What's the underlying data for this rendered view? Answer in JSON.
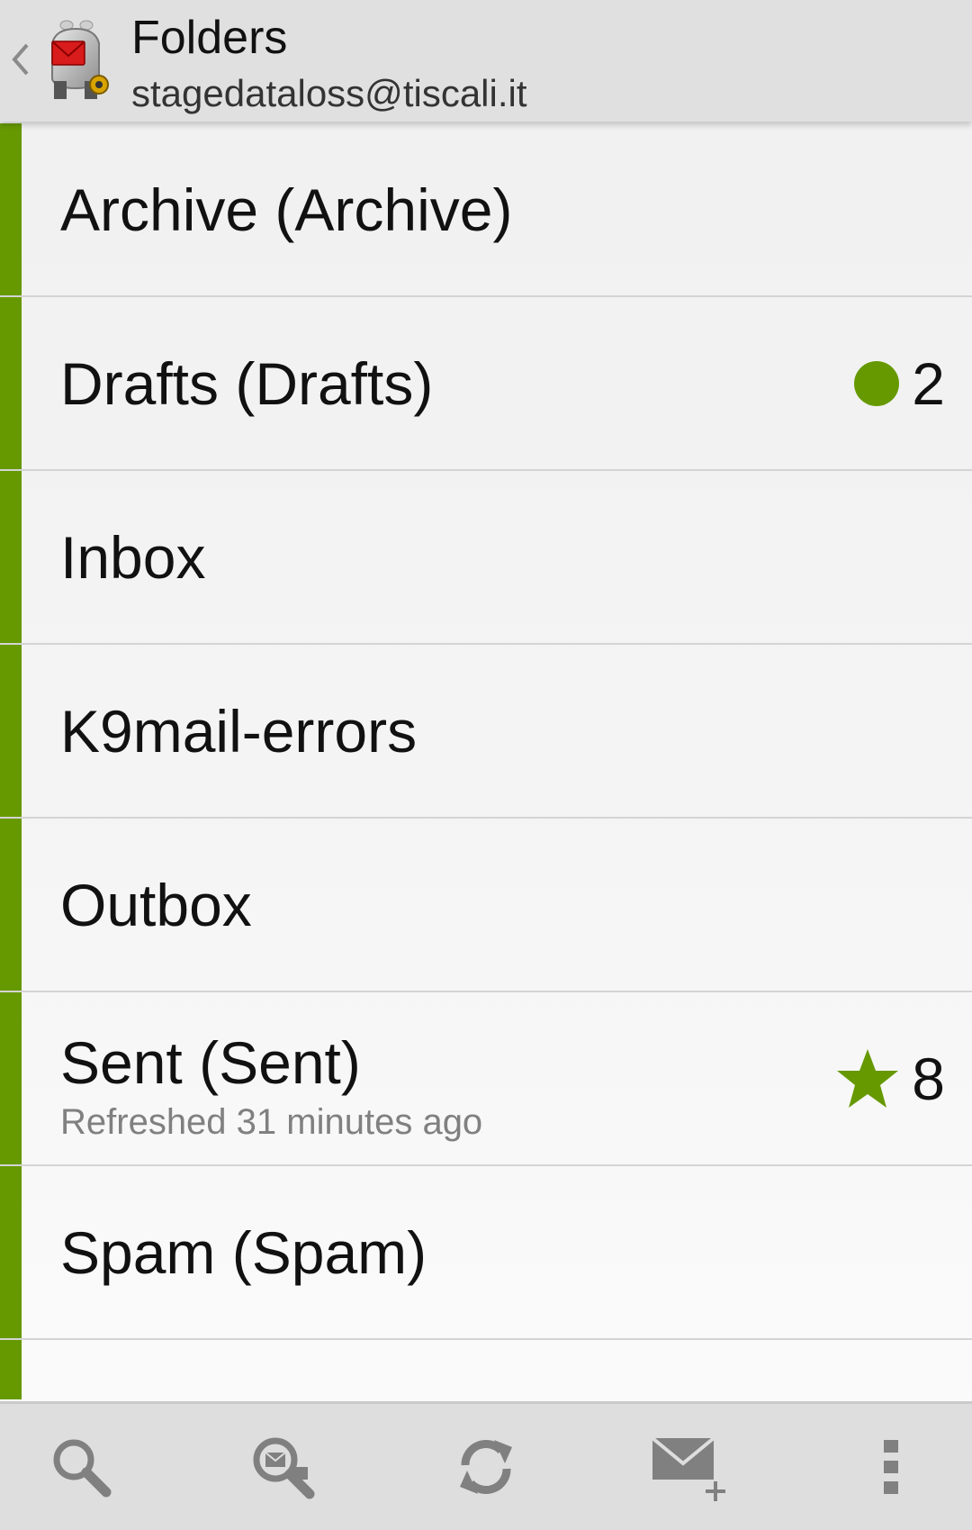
{
  "header": {
    "title": "Folders",
    "subtitle": "stagedataloss@tiscali.it",
    "back_icon": "chevron-left-icon",
    "logo_icon": "k9-mail-logo"
  },
  "accent_color": "#669900",
  "folders": [
    {
      "name": "Archive (Archive)",
      "status": "",
      "count": "",
      "count_icon": ""
    },
    {
      "name": "Drafts (Drafts)",
      "status": "",
      "count": "2",
      "count_icon": "unread-dot-icon"
    },
    {
      "name": "Inbox",
      "status": "",
      "count": "",
      "count_icon": ""
    },
    {
      "name": "K9mail-errors",
      "status": "",
      "count": "",
      "count_icon": ""
    },
    {
      "name": "Outbox",
      "status": "",
      "count": "",
      "count_icon": ""
    },
    {
      "name": "Sent (Sent)",
      "status": "Refreshed 31 minutes ago",
      "count": "8",
      "count_icon": "star-icon"
    },
    {
      "name": "Spam (Spam)",
      "status": "",
      "count": "",
      "count_icon": ""
    }
  ],
  "toolbar": {
    "items": [
      "search-icon",
      "search-remote-icon",
      "refresh-icon",
      "compose-icon",
      "overflow-menu-icon"
    ]
  }
}
